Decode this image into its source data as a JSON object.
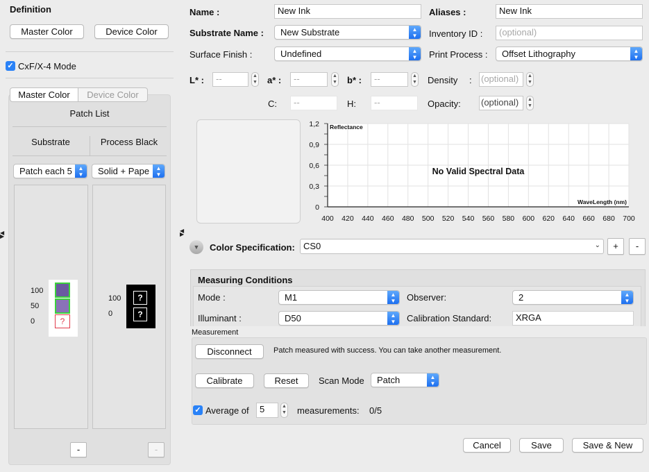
{
  "left": {
    "definition_title": "Definition",
    "master_color_btn": "Master Color",
    "device_color_btn": "Device Color",
    "cxf_mode_label": "CxF/X-4 Mode",
    "tabs": [
      "Master Color",
      "Device Color"
    ],
    "patch_list_title": "Patch List",
    "columns": [
      {
        "header": "Substrate",
        "dropdown": "Patch each 5",
        "levels": [
          "100",
          "50",
          "0"
        ],
        "remove_label": "-"
      },
      {
        "header": "Process Black",
        "dropdown": "Solid + Pape",
        "levels": [
          "100",
          "0"
        ],
        "remove_label": "-"
      }
    ],
    "patch_colors": [
      "#6a5aa0",
      "#8a72b8"
    ],
    "unknown_glyph": "?"
  },
  "form": {
    "name_label": "Name :",
    "name_value": "New Ink",
    "aliases_label": "Aliases :",
    "aliases_value": "New Ink",
    "substrate_label": "Substrate Name :",
    "substrate_value": "New Substrate",
    "inventory_label": "Inventory ID :",
    "inventory_placeholder": "(optional)",
    "surface_label": "Surface Finish :",
    "surface_value": "Undefined",
    "print_label": "Print Process :",
    "print_value": "Offset Lithography",
    "l_label": "L* :",
    "a_label": "a* :",
    "b_label": "b* :",
    "c_label": "C:",
    "h_label": "H:",
    "empty_value": "--",
    "density_label": "Density",
    "density_colon": ":",
    "density_placeholder": "(optional)",
    "opacity_label": "Opacity:",
    "opacity_placeholder": "(optional)"
  },
  "chart_data": {
    "type": "line",
    "ylabel": "Reflectance",
    "xlabel": "WaveLength (nm)",
    "message": "No Valid Spectral Data",
    "x_ticks": [
      "400",
      "420",
      "440",
      "460",
      "480",
      "500",
      "520",
      "540",
      "560",
      "580",
      "600",
      "620",
      "640",
      "660",
      "680",
      "700"
    ],
    "y_ticks": [
      "1,2",
      "0,9",
      "0,6",
      "0,3",
      "0"
    ],
    "xlim": [
      400,
      700
    ],
    "ylim": [
      0,
      1.2
    ],
    "series": []
  },
  "spec": {
    "label": "Color Specification:",
    "value": "CS0",
    "add_label": "+",
    "remove_label": "-"
  },
  "measuring": {
    "title": "Measuring Conditions",
    "mode_label": "Mode :",
    "mode_value": "M1",
    "observer_label": "Observer:",
    "observer_value": "2",
    "illuminant_label": "Illuminant :",
    "illuminant_value": "D50",
    "calibration_label": "Calibration Standard:",
    "calibration_value": "XRGA"
  },
  "measurement": {
    "title": "Measurement",
    "disconnect_label": "Disconnect",
    "status_text": "Patch measured with success. You can take another measurement.",
    "calibrate_label": "Calibrate",
    "reset_label": "Reset",
    "scan_mode_label": "Scan Mode",
    "scan_mode_value": "Patch",
    "average_label": "Average of",
    "average_value": "5",
    "measurements_label": "measurements:",
    "measurements_count": "0/5"
  },
  "footer": {
    "cancel_label": "Cancel",
    "save_label": "Save",
    "save_new_label": "Save & New"
  }
}
